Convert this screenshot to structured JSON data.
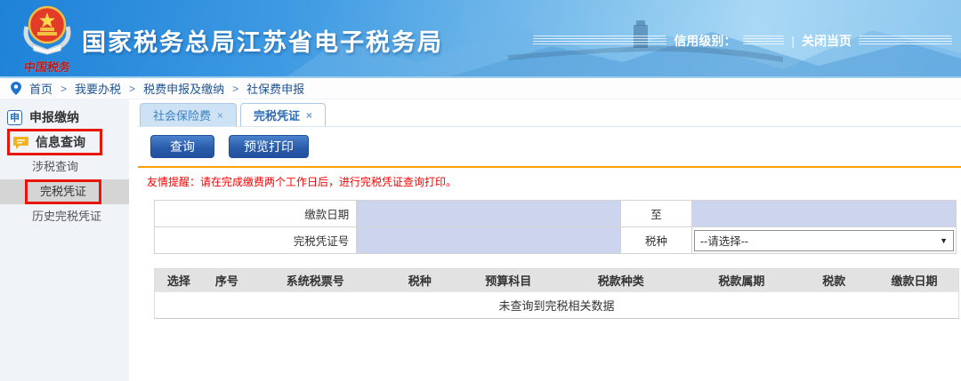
{
  "header": {
    "title": "国家税务总局江苏省电子税务局",
    "logo_caption": "中国税务",
    "credit_label": "信用级别：",
    "divider": "|",
    "close_label": "关闭当页"
  },
  "breadcrumb": {
    "items": [
      "首页",
      "我要办税",
      "税费申报及缴纳",
      "社保费申报"
    ],
    "separator": ">"
  },
  "sidebar": {
    "sections": [
      {
        "label": "申报缴纳",
        "icon": "declare-icon",
        "icon_char": "申"
      },
      {
        "label": "信息查询",
        "icon": "chat-bubble-icon",
        "annotated": true
      }
    ],
    "subitems": [
      {
        "label": "涉税查询"
      },
      {
        "label": "完税凭证",
        "selected": true,
        "annotated": true
      },
      {
        "label": "历史完税凭证"
      }
    ]
  },
  "tabs": [
    {
      "label": "社会保险费",
      "close": "×",
      "active": false
    },
    {
      "label": "完税凭证",
      "close": "×",
      "active": true
    }
  ],
  "toolbar": {
    "query_label": "查询",
    "print_label": "预览打印"
  },
  "notice": "友情提醒：请在完成缴费两个工作日后，进行完税凭证查询打印。",
  "form": {
    "date_label": "缴款日期",
    "to_label": "至",
    "cert_label": "完税凭证号",
    "tax_type_label": "税种",
    "tax_type_value": "--请选择--"
  },
  "table": {
    "headers": [
      "选择",
      "序号",
      "系统税票号",
      "税种",
      "预算科目",
      "税款种类",
      "税款属期",
      "税款",
      "缴款日期"
    ],
    "empty_text": "未查询到完税相关数据"
  },
  "icons": {
    "dropdown_arrow": "▼"
  },
  "colors": {
    "header_blue": "#2e8fdd",
    "button_blue": "#2a5dab",
    "orange_rule": "#ffa000",
    "notice_red": "#fe0000",
    "input_lavender": "#cdd4ee",
    "annotation_red": "#e8150d",
    "tab_inactive": "#cde2f5",
    "table_header_gray": "#e2e2e2"
  }
}
